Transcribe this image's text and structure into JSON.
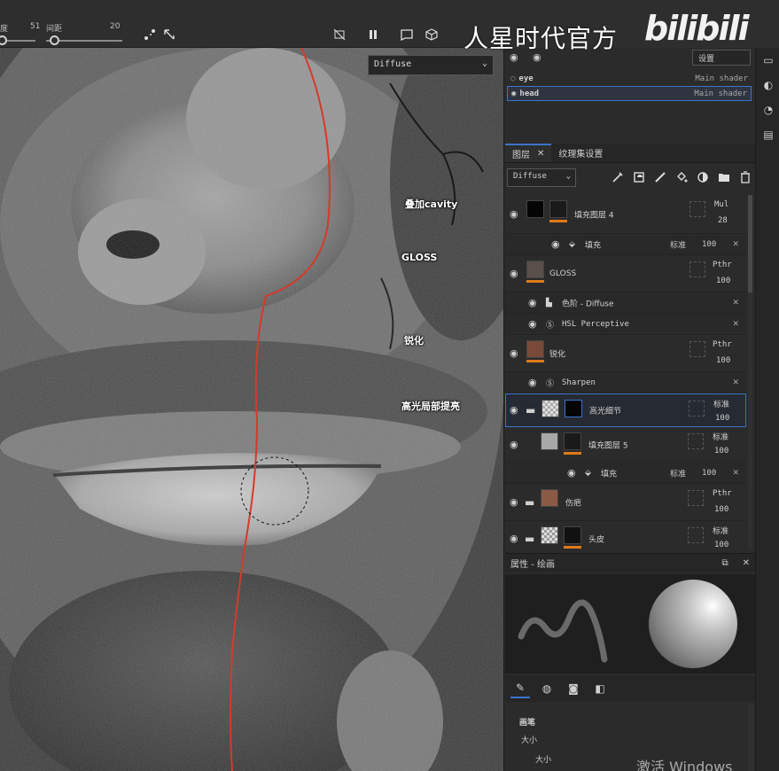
{
  "toolbar": {
    "size_label": "度",
    "size_value": "51",
    "spacing_label": "间距",
    "spacing_value": "20",
    "icons": [
      "symmetry-icon",
      "lazy-mouse-icon",
      "camera-off-icon",
      "pause-icon",
      "camera-icon",
      "cube-icon"
    ]
  },
  "branding": {
    "text": "人星时代官方",
    "logo": "bilibili"
  },
  "viewport": {
    "channel": "Diffuse",
    "annotations": {
      "cavity": "叠加cavity",
      "gloss": "GLOSS",
      "sharpen": "锐化",
      "highlight": "高光局部提亮"
    }
  },
  "shader_list": {
    "dropdown": "设置",
    "items": [
      {
        "name": "eye",
        "shader": "Main shader",
        "selected": false
      },
      {
        "name": "head",
        "shader": "Main shader",
        "selected": true
      }
    ]
  },
  "tabs": [
    {
      "label": "图层",
      "active": true,
      "close": "✕"
    },
    {
      "label": "纹理集设置",
      "active": false
    }
  ],
  "layer_toolbar": {
    "channel": "Diffuse"
  },
  "layers": [
    {
      "type": "main",
      "name": "填充图层 4",
      "blend": "Mul",
      "opacity": "28",
      "thumb_color": "#050505",
      "bar": "#e07a1a"
    },
    {
      "type": "sub",
      "name": "填充",
      "blend": "标准",
      "opacity": "100"
    },
    {
      "type": "main",
      "name": "GLOSS",
      "blend": "Pthr",
      "opacity": "100",
      "thumb_color": "#5a4f4a",
      "bar": "#e07a1a"
    },
    {
      "type": "sub",
      "name": "色阶 - Diffuse"
    },
    {
      "type": "sub",
      "name": "HSL Perceptive"
    },
    {
      "type": "main",
      "name": "锐化",
      "blend": "Pthr",
      "opacity": "100",
      "thumb_color": "#7a4a38",
      "bar": "#e07a1a"
    },
    {
      "type": "sub",
      "name": "Sharpen"
    },
    {
      "type": "folder",
      "name": "高光细节",
      "blend": "标准",
      "opacity": "100",
      "thumb_color": "#d8d8d8",
      "selected": true
    },
    {
      "type": "main",
      "name": "填充图层 5",
      "blend": "标准",
      "opacity": "100",
      "thumb_color": "#a8a8a8",
      "bar": "#e07a1a"
    },
    {
      "type": "sub",
      "name": "填充",
      "blend": "标准",
      "opacity": "100"
    },
    {
      "type": "folder",
      "name": "伤疤",
      "blend": "Pthr",
      "opacity": "100",
      "thumb_color": "#8a5a44"
    },
    {
      "type": "folder",
      "name": "头皮",
      "blend": "标准",
      "opacity": "100",
      "thumb_color": "#bcbcbc"
    }
  ],
  "properties": {
    "title": "属性 - 绘画"
  },
  "tool_props": {
    "section": "画笔",
    "size_label": "大小",
    "size_label2": "大小"
  },
  "watermark": "激活 Windows"
}
